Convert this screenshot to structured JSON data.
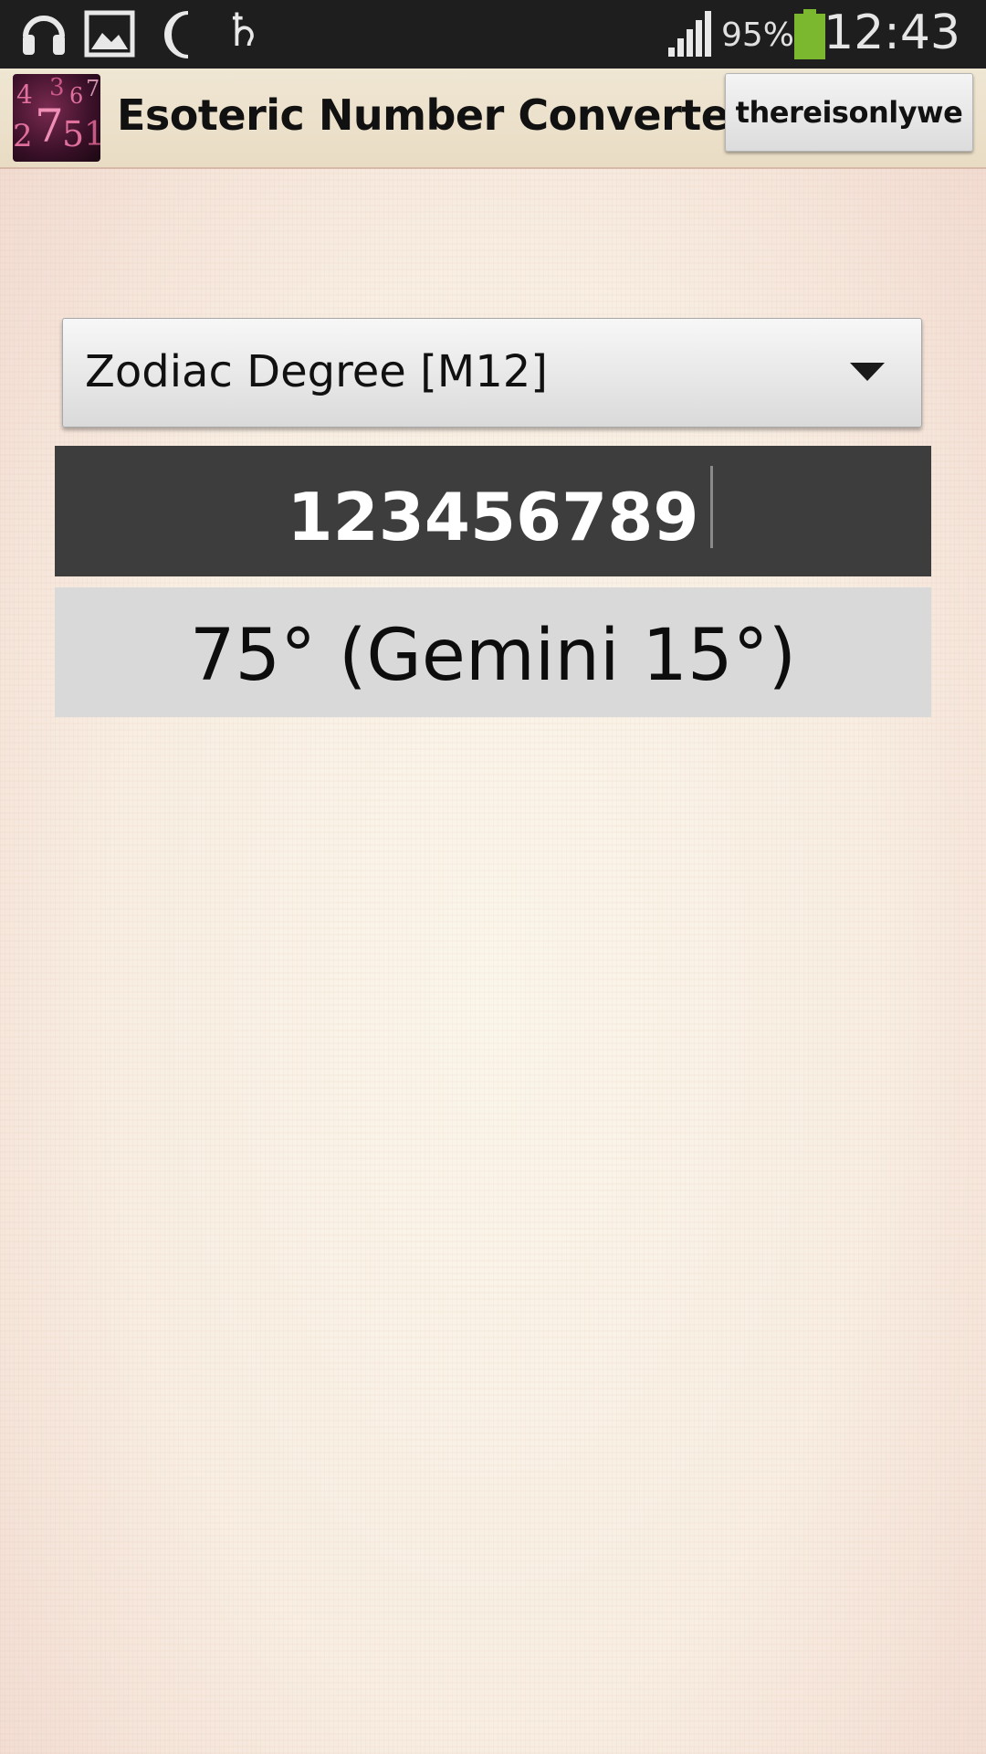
{
  "status_bar": {
    "icons": [
      "headphones-icon",
      "gallery-icon",
      "moon-icon",
      "saturn-symbol-icon",
      "signal-icon",
      "battery-icon"
    ],
    "battery_percent": "95%",
    "battery_color": "#7cb82f",
    "time": "12:43"
  },
  "action_bar": {
    "app_icon_digits": [
      "4",
      "3",
      "6",
      "7",
      "2",
      "7",
      "5",
      "1"
    ],
    "title": "Esoteric Number Converter",
    "user_button_label": "thereisonlywe"
  },
  "converter": {
    "mode_selected": "Zodiac Degree [M12]",
    "input_value": "123456789",
    "result": "75° (Gemini 15°)"
  },
  "colors": {
    "input_background": "#3d3d3d",
    "result_background": "#d9d9d9",
    "status_bar": "#1e1e1e"
  }
}
